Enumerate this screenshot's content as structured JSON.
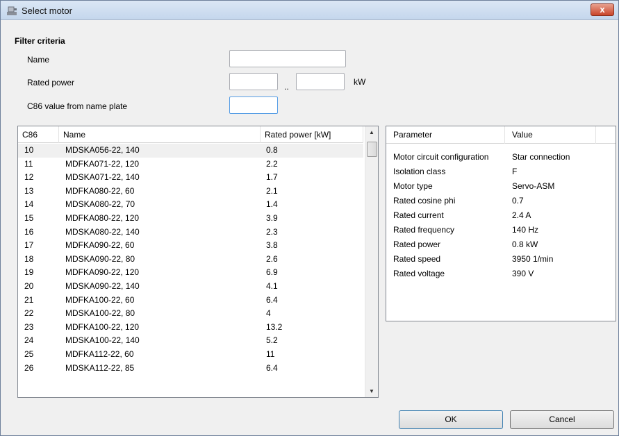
{
  "window": {
    "title": "Select motor",
    "close_label": "x"
  },
  "filter": {
    "section_title": "Filter criteria",
    "name_label": "Name",
    "name_value": "",
    "rated_power_label": "Rated power",
    "power_min": "",
    "range_separator": "..",
    "power_max": "",
    "unit": "kW",
    "c86_label": "C86 value from name plate",
    "c86_value": ""
  },
  "motor_list": {
    "columns": [
      "C86",
      "Name",
      "Rated power [kW]"
    ],
    "rows": [
      [
        "10",
        "MDSKA056-22, 140",
        "0.8"
      ],
      [
        "11",
        "MDFKA071-22, 120",
        "2.2"
      ],
      [
        "12",
        "MDSKA071-22, 140",
        "1.7"
      ],
      [
        "13",
        "MDFKA080-22, 60",
        "2.1"
      ],
      [
        "14",
        "MDSKA080-22, 70",
        "1.4"
      ],
      [
        "15",
        "MDFKA080-22, 120",
        "3.9"
      ],
      [
        "16",
        "MDSKA080-22, 140",
        "2.3"
      ],
      [
        "17",
        "MDFKA090-22, 60",
        "3.8"
      ],
      [
        "18",
        "MDSKA090-22, 80",
        "2.6"
      ],
      [
        "19",
        "MDFKA090-22, 120",
        "6.9"
      ],
      [
        "20",
        "MDSKA090-22, 140",
        "4.1"
      ],
      [
        "21",
        "MDFKA100-22, 60",
        "6.4"
      ],
      [
        "22",
        "MDSKA100-22, 80",
        "4"
      ],
      [
        "23",
        "MDFKA100-22, 120",
        "13.2"
      ],
      [
        "24",
        "MDSKA100-22, 140",
        "5.2"
      ],
      [
        "25",
        "MDFKA112-22, 60",
        "11"
      ],
      [
        "26",
        "MDSKA112-22, 85",
        "6.4"
      ]
    ],
    "selected_index": 0,
    "scroll_up_icon": "up-arrow-icon",
    "scroll_down_icon": "down-arrow-icon"
  },
  "parameters": {
    "columns": [
      "Parameter",
      "Value"
    ],
    "rows": [
      [
        "Motor circuit configuration",
        "Star connection"
      ],
      [
        "Isolation class",
        "F"
      ],
      [
        "Motor type",
        "Servo-ASM"
      ],
      [
        "Rated cosine phi",
        "0.7"
      ],
      [
        "Rated current",
        "2.4 A"
      ],
      [
        "Rated frequency",
        "140 Hz"
      ],
      [
        "Rated power",
        "0.8 kW"
      ],
      [
        "Rated speed",
        "3950 1/min"
      ],
      [
        "Rated voltage",
        "390 V"
      ]
    ]
  },
  "buttons": {
    "ok": "OK",
    "cancel": "Cancel"
  }
}
